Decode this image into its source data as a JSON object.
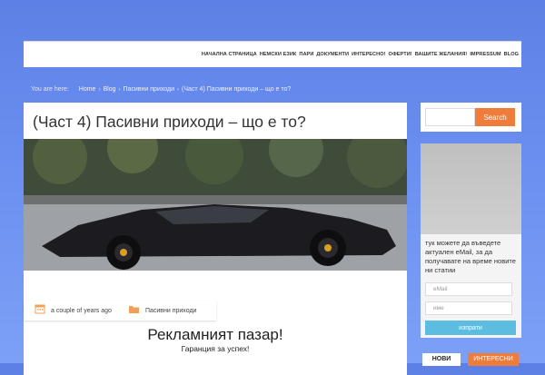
{
  "nav": {
    "items": [
      "НАЧАЛНА СТРАНИЦА",
      "НЕМСКИ ЕЗИК",
      "ПАРИ",
      "ДОКУМЕНТИ",
      "ИНТЕРЕСНО!",
      "ОФЕРТИ!",
      "ВАШИТЕ ЖЕЛАНИЯ!",
      "IMPRESSUM",
      "BLOG"
    ]
  },
  "breadcrumb": {
    "label": "You are here:",
    "items": [
      "Home",
      "Blog",
      "Пасивни приходи",
      "(Част 4) Пасивни приходи – що е то?"
    ],
    "separator": "›"
  },
  "post": {
    "title": "(Част 4) Пасивни приходи – що е то?",
    "date": "a couple of years ago",
    "category": "Пасивни приходи",
    "ad_title": "Рекламният пазар!",
    "ad_subtitle": "Гаранция за успех!"
  },
  "sidebar": {
    "search_button": "Search",
    "optin_text": "тук можете да въведете актуален eMail, за да получавате на време новите ни статии",
    "email_placeholder": "eMail",
    "name_placeholder": "име",
    "submit_label": "изпрати",
    "tabs": [
      "НОВИ",
      "ИНТЕРЕСНИ"
    ]
  },
  "colors": {
    "accent": "#f07c3c",
    "button_blue": "#5dbde0",
    "background": "#6b8ff0"
  },
  "icons": {
    "calendar": "calendar-icon",
    "folder": "folder-icon"
  }
}
